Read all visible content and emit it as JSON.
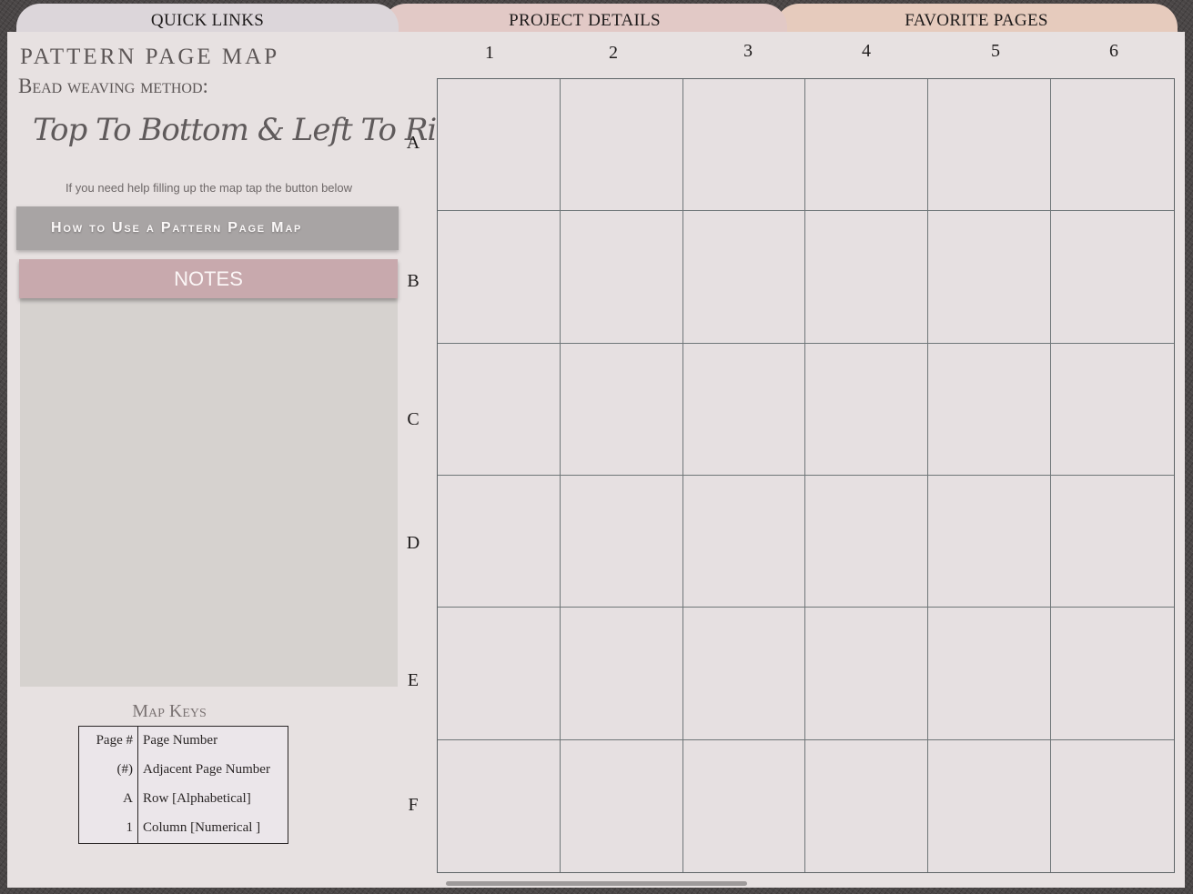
{
  "tabs": [
    {
      "label": "QUICK  LINKS"
    },
    {
      "label": "PROJECT  DETAILS"
    },
    {
      "label": "FAVORITE  PAGES"
    }
  ],
  "page": {
    "title": "PATTERN PAGE MAP",
    "subtitle": "Bead weaving method:",
    "method": "Top To Bottom & Left To Right",
    "help_text": "If you need help filling up the map tap the button below",
    "howto_button": "How to Use a Pattern Page Map",
    "notes_button": "NOTES",
    "notes_value": ""
  },
  "map_keys": {
    "title": "Map Keys",
    "rows": [
      {
        "key": "Page #",
        "value": "Page Number"
      },
      {
        "key": "(#)",
        "value": "Adjacent Page Number"
      },
      {
        "key": "A",
        "value": "Row [Alphabetical]"
      },
      {
        "key": "1",
        "value": "Column [Numerical ]"
      }
    ]
  },
  "grid": {
    "columns": [
      "1",
      "2",
      "3",
      "4",
      "5",
      "6"
    ],
    "rows": [
      "A",
      "B",
      "C",
      "D",
      "E",
      "F"
    ]
  },
  "colors": {
    "page_bg": "#e7e1e1",
    "notes_accent": "#c8a9ad",
    "howto_button": "#a8a4a4",
    "grid_line": "#6f7678"
  }
}
